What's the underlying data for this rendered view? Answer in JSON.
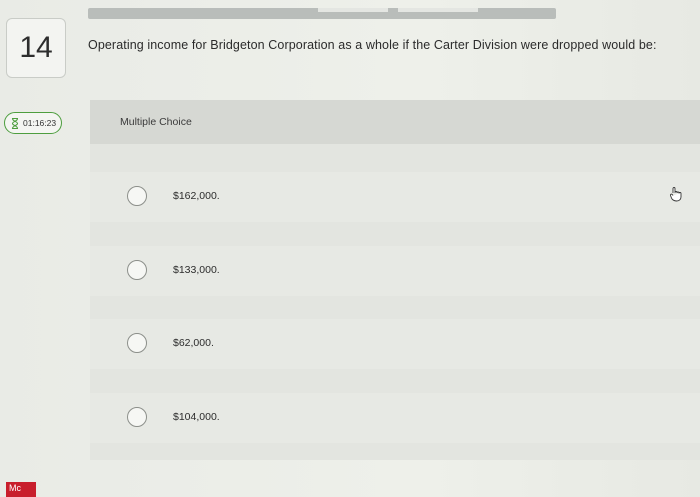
{
  "question": {
    "number": "14",
    "text": "Operating income for Bridgeton Corporation as a whole if the Carter Division were dropped would be:"
  },
  "timer": {
    "value": "01:16:23",
    "icon": "hourglass-icon"
  },
  "answer_panel": {
    "type_label": "Multiple Choice",
    "options": [
      {
        "label": "$162,000."
      },
      {
        "label": "$133,000."
      },
      {
        "label": "$62,000."
      },
      {
        "label": "$104,000."
      }
    ]
  },
  "logo": {
    "text": "Mc",
    "color": "#c81e2c"
  },
  "colors": {
    "timer_border": "#4e9e3f",
    "accent": "#c81e2c"
  }
}
